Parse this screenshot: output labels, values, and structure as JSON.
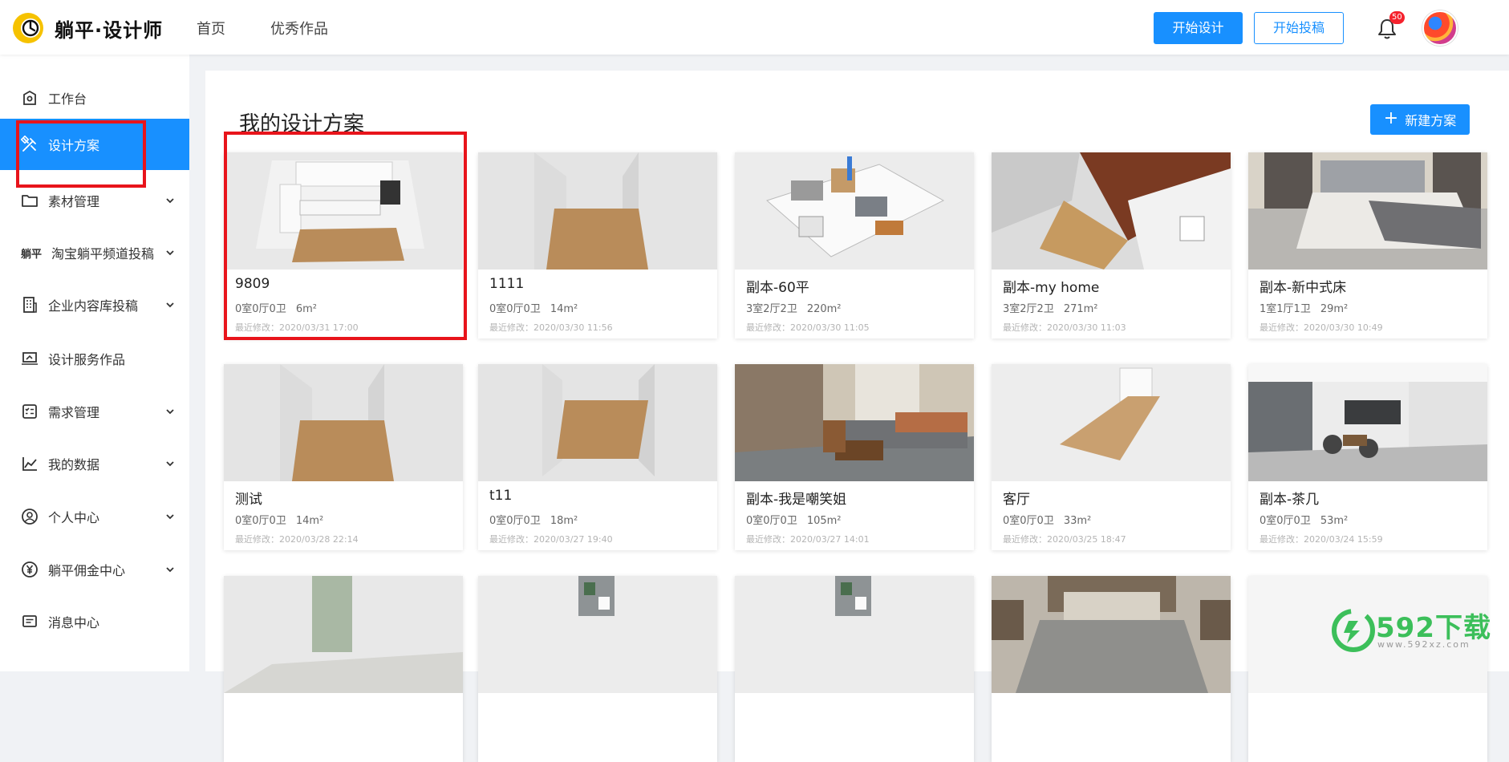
{
  "header": {
    "logo_text": "躺平·设计师",
    "nav": [
      {
        "label": "首页"
      },
      {
        "label": "优秀作品"
      }
    ],
    "start_design_label": "开始设计",
    "start_submit_label": "开始投稿",
    "notification_count": "50"
  },
  "sidebar": {
    "items": [
      {
        "label": "工作台",
        "icon": "home-icon",
        "chevron": false
      },
      {
        "label": "设计方案",
        "icon": "tools-icon",
        "chevron": false,
        "active": true
      },
      {
        "label": "素材管理",
        "icon": "folder-icon",
        "chevron": true
      },
      {
        "label": "淘宝躺平频道投稿",
        "icon": "brand-logo",
        "brand_text": "躺平",
        "chevron": true
      },
      {
        "label": "企业内容库投稿",
        "icon": "building-icon",
        "chevron": true
      },
      {
        "label": "设计服务作品",
        "icon": "laptop-icon",
        "chevron": false
      },
      {
        "label": "需求管理",
        "icon": "checklist-icon",
        "chevron": true
      },
      {
        "label": "我的数据",
        "icon": "chart-icon",
        "chevron": true
      },
      {
        "label": "个人中心",
        "icon": "user-icon",
        "chevron": true
      },
      {
        "label": "躺平佣金中心",
        "icon": "yen-icon",
        "chevron": true
      },
      {
        "label": "消息中心",
        "icon": "message-icon",
        "chevron": false
      }
    ]
  },
  "main": {
    "title": "我的设计方案",
    "new_button_label": "新建方案",
    "cards": [
      {
        "name": "9809",
        "rooms": "0室0厅0卫",
        "area": "6m²",
        "date": "最近修改：2020/03/31 17:00",
        "thumb": "kitchen-render"
      },
      {
        "name": "1111",
        "rooms": "0室0厅0卫",
        "area": "14m²",
        "date": "最近修改：2020/03/30 11:56",
        "thumb": "empty-room"
      },
      {
        "name": "副本-60平",
        "rooms": "3室2厅2卫",
        "area": "220m²",
        "date": "最近修改：2020/03/30 11:05",
        "thumb": "floorplan-3d"
      },
      {
        "name": "副本-my home",
        "rooms": "3室2厅2卫",
        "area": "271m²",
        "date": "最近修改：2020/03/30 11:03",
        "thumb": "cutaway-room"
      },
      {
        "name": "副本-新中式床",
        "rooms": "1室1厅1卫",
        "area": "29m²",
        "date": "最近修改：2020/03/30 10:49",
        "thumb": "bedroom"
      },
      {
        "name": "测试",
        "rooms": "0室0厅0卫",
        "area": "14m²",
        "date": "最近修改：2020/03/28 22:14",
        "thumb": "empty-room"
      },
      {
        "name": "t11",
        "rooms": "0室0厅0卫",
        "area": "18m²",
        "date": "最近修改：2020/03/27 19:40",
        "thumb": "empty-room-wide"
      },
      {
        "name": "副本-我是嘲笑姐",
        "rooms": "0室0厅0卫",
        "area": "105m²",
        "date": "最近修改：2020/03/27 14:01",
        "thumb": "living-room"
      },
      {
        "name": "客厅",
        "rooms": "0室0厅0卫",
        "area": "33m²",
        "date": "最近修改：2020/03/25 18:47",
        "thumb": "empty-room-window"
      },
      {
        "name": "副本-茶几",
        "rooms": "0室0厅0卫",
        "area": "53m²",
        "date": "最近修改：2020/03/24 15:59",
        "thumb": "tea-room"
      },
      {
        "name": "",
        "rooms": "",
        "area": "",
        "date": "",
        "thumb": "door-room"
      },
      {
        "name": "",
        "rooms": "",
        "area": "",
        "date": "",
        "thumb": "small-model"
      },
      {
        "name": "",
        "rooms": "",
        "area": "",
        "date": "",
        "thumb": "small-model"
      },
      {
        "name": "",
        "rooms": "",
        "area": "",
        "date": "",
        "thumb": "bedroom-2"
      },
      {
        "name": "",
        "rooms": "",
        "area": "",
        "date": "",
        "thumb": "blank"
      }
    ]
  },
  "watermark": {
    "text": "592下载",
    "sub": "www.592xz.com"
  },
  "colors": {
    "accent": "#1890ff",
    "annotation": "#e8141b",
    "watermark": "#3cbf5a"
  }
}
